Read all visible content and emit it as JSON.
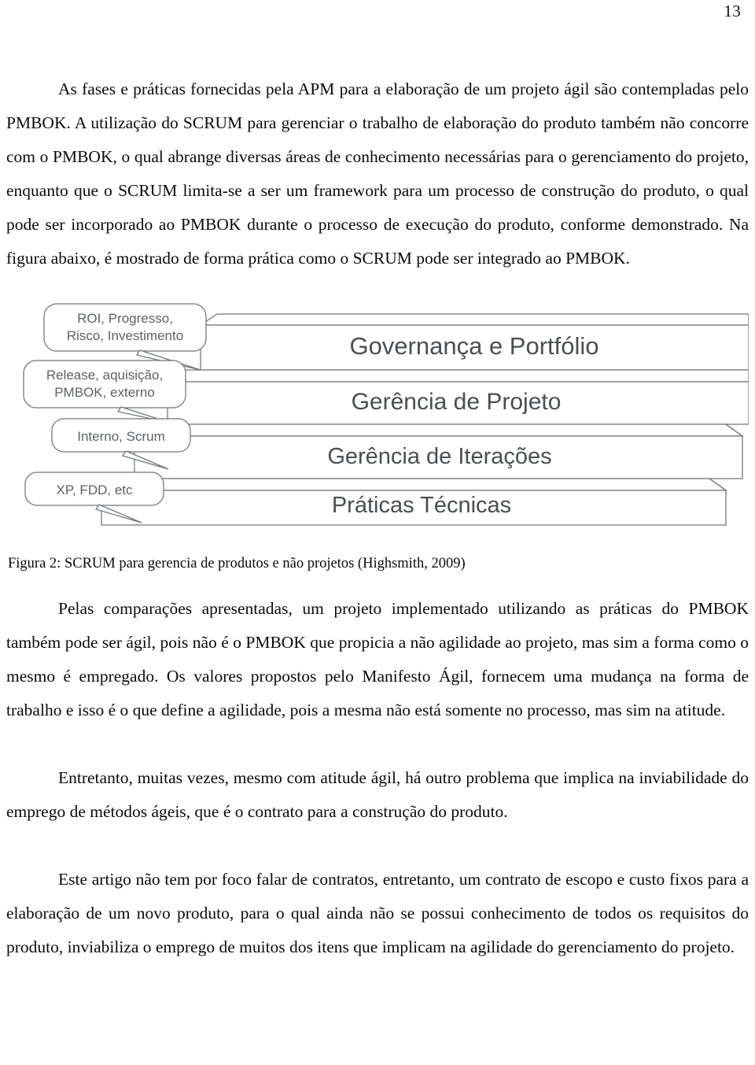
{
  "page": {
    "number": "13"
  },
  "paragraphs": {
    "p1": "As fases e práticas fornecidas pela APM para a elaboração de um projeto ágil são contempladas pelo PMBOK. A utilização do SCRUM para gerenciar o trabalho de elaboração do produto também não concorre com o PMBOK, o qual abrange diversas áreas de conhecimento necessárias para o gerenciamento do projeto, enquanto que o SCRUM limita-se a ser um framework para um processo de construção do produto, o qual pode ser incorporado ao PMBOK durante o processo de execução do produto, conforme demonstrado. Na figura abaixo, é mostrado de forma prática como o SCRUM pode ser integrado ao PMBOK.",
    "p2": "Pelas comparações apresentadas, um projeto implementado utilizando as práticas do PMBOK também pode ser ágil, pois não é o PMBOK que propicia a não agilidade ao projeto, mas sim a forma como o mesmo é empregado. Os valores propostos pelo Manifesto Ágil, fornecem uma mudança na forma de trabalho e isso é o que define a agilidade, pois a mesma não está somente no processo, mas sim na atitude.",
    "p3": "Entretanto, muitas vezes, mesmo com atitude ágil, há outro problema que implica na inviabilidade do emprego de métodos ágeis, que é o contrato para a construção do produto.",
    "p4": "Este artigo não tem por foco falar de contratos, entretanto, um contrato de escopo e custo fixos para a elaboração de um novo produto, para o qual ainda não se possui conhecimento de todos os requisitos do produto, inviabiliza o emprego de muitos dos itens que implicam na agilidade do gerenciamento do projeto."
  },
  "figure": {
    "caption": "Figura 2: SCRUM para gerencia de produtos e não projetos (Highsmith, 2009)",
    "steps": [
      {
        "label": "Governança e Portfólio"
      },
      {
        "label": "Gerência de Projeto"
      },
      {
        "label": "Gerência de Iterações"
      },
      {
        "label": "Práticas Técnicas"
      }
    ],
    "callouts": [
      {
        "line1": "ROI, Progresso,",
        "line2": "Risco, Investimento"
      },
      {
        "line1": "Release, aquisição,",
        "line2": "PMBOK, externo"
      },
      {
        "line1": "Interno, Scrum",
        "line2": ""
      },
      {
        "line1": "XP, FDD, etc",
        "line2": ""
      }
    ],
    "colors": {
      "stroke": "#6f7679",
      "step_text": "#4a4f52",
      "callout_text": "#5c6265",
      "fill": "#ffffff"
    }
  }
}
